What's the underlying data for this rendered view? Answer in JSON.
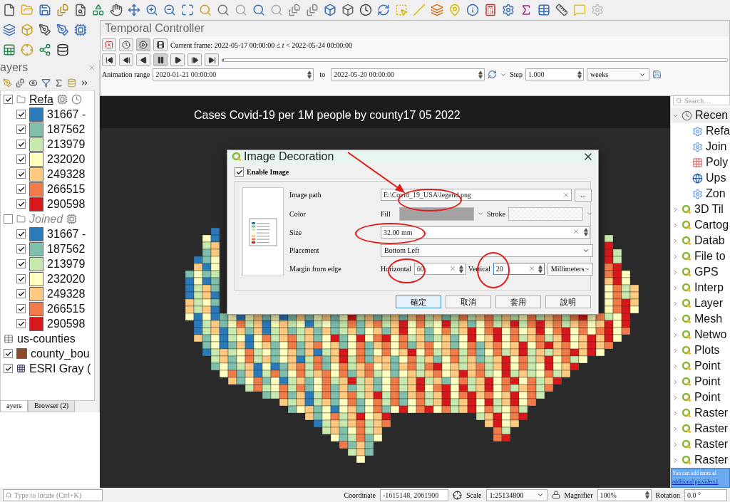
{
  "temporal_controller": {
    "title": "Temporal Controller",
    "modes": [
      {
        "selected": false
      },
      {
        "selected": false
      },
      {
        "selected": true
      },
      {
        "selected": false
      }
    ],
    "current_frame": "Current frame: 2022-05-17 00:00:00 ≤ *t* < 2022-05-24 00:00:00",
    "playback": [
      {
        "selected": false
      },
      {
        "selected": false
      },
      {
        "selected": false
      },
      {
        "selected": true
      },
      {
        "selected": false
      },
      {
        "selected": false
      },
      {
        "selected": false
      }
    ],
    "slider": {
      "level": 0
    },
    "range_label": "Animation range",
    "range_start": "2020-01-21 00:00:00",
    "to_label": "to",
    "range_end": "2022-05-20 00:00:00",
    "step_label": "Step",
    "step_value": "1.000",
    "step_unit": "weeks"
  },
  "layers_panel": {
    "title": "ayers",
    "groups": [
      {
        "name": "Refa",
        "checked": true,
        "legend": [
          {
            "label": "31667 -",
            "checked": true,
            "color": "#2b7bba"
          },
          {
            "label": "187562",
            "checked": true,
            "color": "#80bfac"
          },
          {
            "label": "213979",
            "checked": true,
            "color": "#c7e9ad"
          },
          {
            "label": "232020",
            "checked": true,
            "color": "#ffffbf"
          },
          {
            "label": "249328",
            "checked": true,
            "color": "#fec980"
          },
          {
            "label": "266515",
            "checked": true,
            "color": "#f17c4a"
          },
          {
            "label": "290598",
            "checked": true,
            "color": "#d7191c"
          }
        ]
      },
      {
        "name": "Joined",
        "checked": false,
        "legend": [
          {
            "label": "31667 -",
            "checked": true,
            "color": "#2b7bba"
          },
          {
            "label": "187562",
            "checked": true,
            "color": "#80bfac"
          },
          {
            "label": "213979",
            "checked": true,
            "color": "#c7e9ad"
          },
          {
            "label": "232020",
            "checked": true,
            "color": "#ffffbf"
          },
          {
            "label": "249328",
            "checked": true,
            "color": "#fec980"
          },
          {
            "label": "266515",
            "checked": true,
            "color": "#f17c4a"
          },
          {
            "label": "290598",
            "checked": true,
            "color": "#d7191c"
          }
        ]
      }
    ],
    "layers": [
      {
        "name": "us-counties",
        "kind": "table"
      },
      {
        "name": "county_bou",
        "kind": "fill",
        "checked": true,
        "color": "#8b4a2b"
      },
      {
        "name": "ESRI Gray (",
        "kind": "raster",
        "checked": true
      }
    ],
    "tabs": [
      {
        "label": "ayers",
        "selected": true
      },
      {
        "label": "Browser (2)",
        "selected": false
      }
    ]
  },
  "map": {
    "title": "Cases Covid-19 per 1M people by county17 05 2022"
  },
  "dialog": {
    "title": "Image Decoration",
    "enable_label": "Enable Image",
    "enabled": true,
    "image_path_label": "Image path",
    "image_path": "E:\\Covid_19_USA\\legend.png",
    "browse": "...",
    "color_label": "Color",
    "fill_label": "Fill",
    "stroke_label": "Stroke",
    "size_label": "Size",
    "size": "32.00 mm",
    "placement_label": "Placement",
    "placement": "Bottom Left",
    "margin_label": "Margin from edge",
    "horizontal_label": "Horizontal",
    "horizontal": "60",
    "vertical_label": "Vertical",
    "vertical": "20",
    "units": "Millimeters",
    "buttons": [
      {
        "label": "確定",
        "default": true
      },
      {
        "label": "取消",
        "default": false
      },
      {
        "label": "套用",
        "default": false
      },
      {
        "label": "說明",
        "default": false
      }
    ]
  },
  "processing": {
    "search_placeholder": "Search…",
    "tree": [
      {
        "label": "Recen",
        "kind": "recent",
        "expanded": true,
        "children": [
          {
            "label": "Refa",
            "kind": "gear"
          },
          {
            "label": "Join",
            "kind": "gear"
          },
          {
            "label": "Poly",
            "kind": "grid"
          },
          {
            "label": "Ups",
            "kind": "globe"
          },
          {
            "label": "Zon",
            "kind": "gear"
          }
        ]
      },
      {
        "label": "3D Til",
        "kind": "provider",
        "expanded": false
      },
      {
        "label": "Cartog",
        "kind": "provider",
        "expanded": false
      },
      {
        "label": "Datab",
        "kind": "provider",
        "expanded": false
      },
      {
        "label": "File to",
        "kind": "provider",
        "expanded": false
      },
      {
        "label": "GPS",
        "kind": "provider",
        "expanded": false
      },
      {
        "label": "Interp",
        "kind": "provider",
        "expanded": false
      },
      {
        "label": "Layer",
        "kind": "provider",
        "expanded": false
      },
      {
        "label": "Mesh",
        "kind": "provider",
        "expanded": false
      },
      {
        "label": "Netwo",
        "kind": "provider",
        "expanded": false
      },
      {
        "label": "Plots",
        "kind": "provider",
        "expanded": false
      },
      {
        "label": "Point",
        "kind": "provider",
        "expanded": false
      },
      {
        "label": "Point",
        "kind": "provider",
        "expanded": false
      },
      {
        "label": "Point",
        "kind": "provider",
        "expanded": false
      },
      {
        "label": "Raster",
        "kind": "provider",
        "expanded": false
      },
      {
        "label": "Raster",
        "kind": "provider",
        "expanded": false
      },
      {
        "label": "Raster",
        "kind": "provider",
        "expanded": false
      },
      {
        "label": "Raster",
        "kind": "provider",
        "expanded": false
      }
    ],
    "notice": "You can add more al",
    "notice_link": "additional providers.["
  },
  "status_bar": {
    "locate_placeholder": "Type to locate (Ctrl+K)",
    "coordinate_label": "Coordinate",
    "coordinate": "-1615148, 2061900",
    "scale_label": "Scale",
    "scale": "1:25134800",
    "magnifier_label": "Magnifier",
    "magnifier": "100%",
    "rotation_label": "Rotation",
    "rotation": "0.0 °"
  }
}
